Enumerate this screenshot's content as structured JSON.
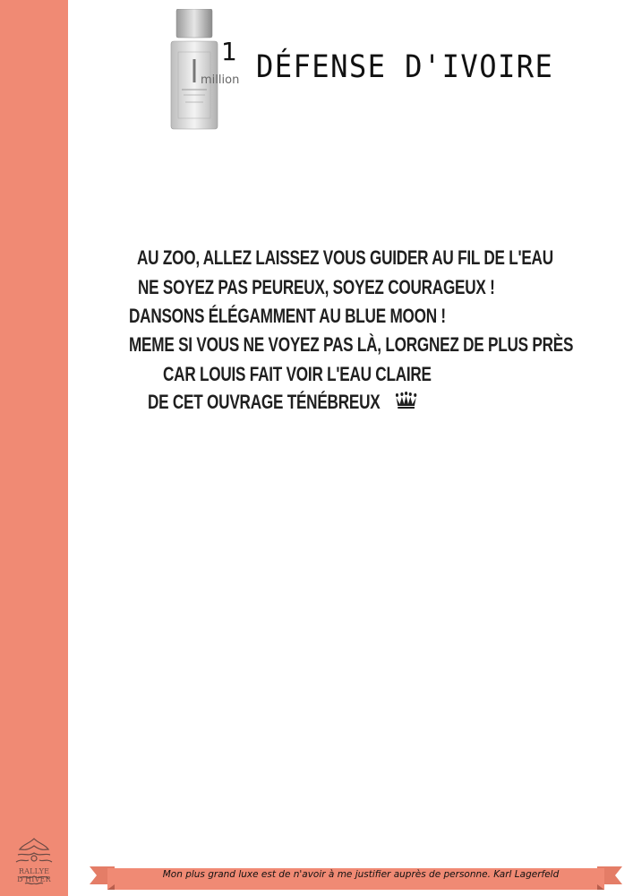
{
  "logo": {
    "text": "RALLYE D'HIVER"
  },
  "header": {
    "brand_number": "1",
    "brand_word": "million",
    "title": "DÉFENSE D'IVOIRE"
  },
  "poem": {
    "lines": [
      "AU ZOO, ALLEZ LAISSEZ VOUS GUIDER AU FIL DE L'EAU",
      "NE SOYEZ PAS PEUREUX, SOYEZ COURAGEUX !",
      "DANSONS ÉLÉGAMMENT AU BLUE MOON !",
      "MEME SI VOUS NE VOYEZ PAS LÀ, LORGNEZ DE PLUS PRÈS",
      "CAR LOUIS FAIT VOIR L'EAU CLAIRE",
      "DE CET OUVRAGE TÉNÉBREUX"
    ]
  },
  "footer": {
    "quote": "Mon plus grand luxe est de n'avoir à me justifier auprès de personne. Karl Lagerfeld"
  },
  "colors": {
    "accent": "#f08a74",
    "text": "#1f1f1f"
  },
  "icons": {
    "crown": "crown-icon",
    "bottle": "perfume-bottle-icon",
    "logo": "ornament-logo"
  }
}
